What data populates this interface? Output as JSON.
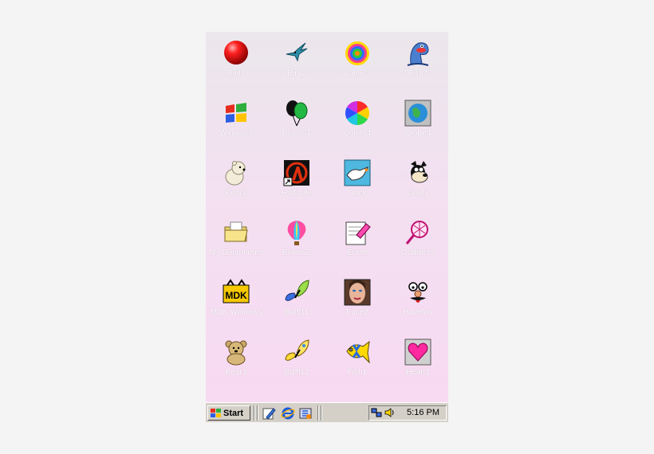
{
  "desktop": {
    "icons": [
      {
        "label": "Ball2",
        "icon": "red-ball-icon"
      },
      {
        "label": "Bird2",
        "icon": "hummingbird-icon"
      },
      {
        "label": "Colors3",
        "icon": "color-swirl-icon"
      },
      {
        "label": "Fish4",
        "icon": "fish-icon"
      },
      {
        "label": "Window3",
        "icon": "windows-logo-icon"
      },
      {
        "label": "Bloons1",
        "icon": "balloons-icon"
      },
      {
        "label": "Colors4",
        "icon": "color-wheel-icon"
      },
      {
        "label": "Globe4",
        "icon": "globe-icon"
      },
      {
        "label": "Bear2",
        "icon": "polar-bear-icon"
      },
      {
        "label": "Half-Life",
        "icon": "half-life-icon"
      },
      {
        "label": "Duck",
        "icon": "duck-icon"
      },
      {
        "label": "Goofy",
        "icon": "goofy-icon"
      },
      {
        "label": "My Documents",
        "icon": "folder-icon"
      },
      {
        "label": "Bloons2",
        "icon": "hot-air-balloon-icon"
      },
      {
        "label": "Erase",
        "icon": "eraser-icon"
      },
      {
        "label": "Grabber3",
        "icon": "net-icon"
      },
      {
        "label": "MDK Windows",
        "icon": "mdk-icon"
      },
      {
        "label": "Butfl11",
        "icon": "butterfly-icon"
      },
      {
        "label": "Face2",
        "icon": "face-icon"
      },
      {
        "label": "Havefun",
        "icon": "funny-face-icon"
      },
      {
        "label": "Bear3",
        "icon": "teddy-bear-icon"
      },
      {
        "label": "Butfl12",
        "icon": "butterfly-yellow-icon"
      },
      {
        "label": "Fish1",
        "icon": "flounder-fish-icon"
      },
      {
        "label": "Heart1",
        "icon": "heart-icon"
      }
    ]
  },
  "taskbar": {
    "start_label": "Start",
    "clock": "5:16 PM",
    "quick_launch": [
      "pen-icon",
      "internet-explorer-icon",
      "channels-icon"
    ],
    "tray": [
      "network-icon",
      "volume-icon"
    ]
  },
  "colors": {
    "desktop_top": "#ebe7ec",
    "desktop_bottom": "#f8d9f2",
    "taskbar": "#d4d0c8"
  }
}
